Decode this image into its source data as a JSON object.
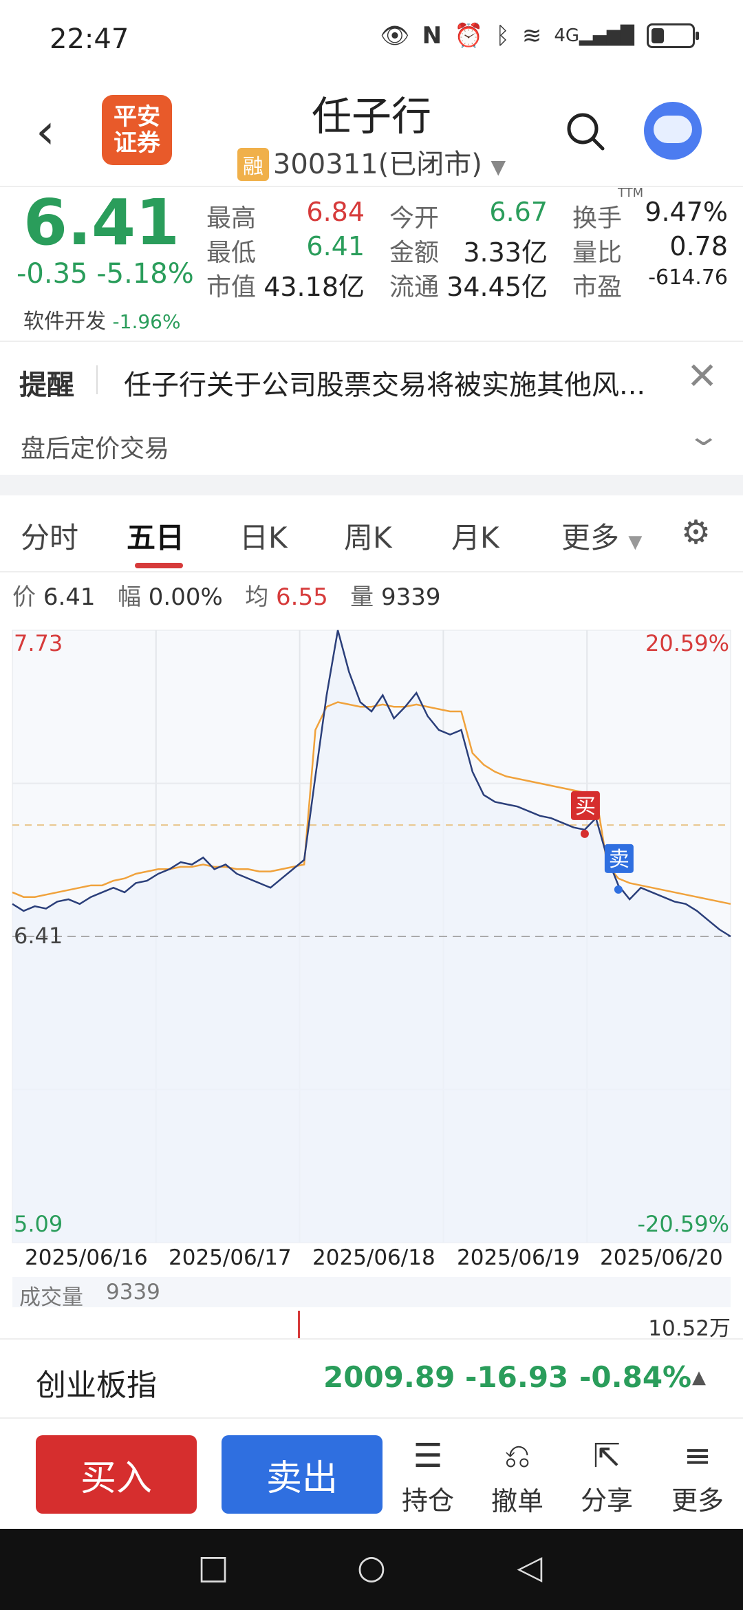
{
  "status_bar": {
    "time": "22:47",
    "icons": [
      "eye-icon",
      "nfc-icon",
      "alarm-icon",
      "bluetooth-icon",
      "wifi-icon",
      "signal-4g-icon",
      "battery-icon"
    ],
    "network": "4G",
    "battery_level": 0.35
  },
  "header": {
    "title": "任子行",
    "badge": "融",
    "code": "300311",
    "market_status": "(已闭市)",
    "logo_line1": "平安",
    "logo_line2": "证券"
  },
  "quote": {
    "price": "6.41",
    "change": "-0.35",
    "change_pct": "-5.18%",
    "sector": "软件开发",
    "sector_pct": "-1.96%",
    "fields": [
      {
        "label": "最高",
        "value": "6.84",
        "color": "red"
      },
      {
        "label": "今开",
        "value": "6.67",
        "color": "green"
      },
      {
        "label": "换手",
        "value": "9.47%",
        "color": "plain"
      },
      {
        "label": "最低",
        "value": "6.41",
        "color": "green"
      },
      {
        "label": "金额",
        "value": "3.33亿",
        "color": "plain"
      },
      {
        "label": "量比",
        "value": "0.78",
        "color": "plain"
      },
      {
        "label": "市值",
        "value": "43.18亿",
        "color": "plain"
      },
      {
        "label": "流通",
        "value": "34.45亿",
        "color": "plain"
      },
      {
        "label": "市盈",
        "value": "-614.76",
        "color": "plain"
      }
    ],
    "ttm": "TTM"
  },
  "notice": {
    "label": "提醒",
    "text": "任子行关于公司股票交易将被实施其他风...",
    "after_hours": "盘后定价交易"
  },
  "tabs": [
    {
      "label": "分时"
    },
    {
      "label": "五日"
    },
    {
      "label": "日K"
    },
    {
      "label": "周K"
    },
    {
      "label": "月K"
    },
    {
      "label": "更多"
    }
  ],
  "info_bar": {
    "price_label": "价",
    "price": "6.41",
    "amp_label": "幅",
    "amp": "0.00%",
    "avg_label": "均",
    "avg": "6.55",
    "vol_label": "量",
    "vol": "9339"
  },
  "chart_data": {
    "type": "line",
    "y_top_label": "7.73",
    "y_bottom_label": "5.09",
    "pct_top": "20.59%",
    "pct_bottom": "-20.59%",
    "current_label": "6.41",
    "ylim": [
      5.09,
      7.73
    ],
    "prev_close_ref": 6.89,
    "current_price": 6.41,
    "days": [
      "2025/06/16",
      "2025/06/17",
      "2025/06/18",
      "2025/06/19",
      "2025/06/20"
    ],
    "series": [
      {
        "values": [
          6.55,
          6.52,
          6.54,
          6.53,
          6.56,
          6.57,
          6.55,
          6.58,
          6.6,
          6.62,
          6.6,
          6.64,
          6.65,
          6.68,
          6.7,
          6.73,
          6.72,
          6.75,
          6.7,
          6.72,
          6.68,
          6.66,
          6.64,
          6.62,
          6.66,
          6.7,
          6.74,
          7.1,
          7.45,
          7.73,
          7.55,
          7.42,
          7.38,
          7.45,
          7.35,
          7.4,
          7.46,
          7.36,
          7.3,
          7.28,
          7.3,
          7.12,
          7.02,
          6.99,
          6.98,
          6.97,
          6.95,
          6.93,
          6.92,
          6.9,
          6.88,
          6.87,
          6.92,
          6.75,
          6.63,
          6.57,
          6.62,
          6.6,
          6.58,
          6.56,
          6.55,
          6.52,
          6.48,
          6.44,
          6.41
        ]
      },
      {
        "values": [
          6.6,
          6.58,
          6.58,
          6.59,
          6.6,
          6.61,
          6.62,
          6.63,
          6.63,
          6.65,
          6.66,
          6.68,
          6.69,
          6.7,
          6.7,
          6.71,
          6.71,
          6.72,
          6.71,
          6.71,
          6.7,
          6.7,
          6.69,
          6.69,
          6.7,
          6.71,
          6.72,
          7.3,
          7.4,
          7.42,
          7.41,
          7.4,
          7.4,
          7.41,
          7.4,
          7.4,
          7.41,
          7.4,
          7.39,
          7.38,
          7.38,
          7.2,
          7.15,
          7.12,
          7.1,
          7.09,
          7.08,
          7.07,
          7.06,
          7.05,
          7.04,
          7.03,
          7.02,
          6.72,
          6.66,
          6.64,
          6.63,
          6.62,
          6.61,
          6.6,
          6.59,
          6.58,
          6.57,
          6.56,
          6.55
        ]
      }
    ],
    "markers": [
      {
        "label": "买",
        "index": 51
      },
      {
        "label": "卖",
        "index": 54
      }
    ]
  },
  "volume": {
    "label": "成交量",
    "value": "9339",
    "max_label": "10.52万"
  },
  "index_bar": {
    "name": "创业板指",
    "value": "2009.89",
    "change": "-16.93",
    "change_pct": "-0.84%"
  },
  "bottom_bar": {
    "buy": "买入",
    "sell": "卖出",
    "hold": "持仓",
    "cancel": "撤单",
    "share": "分享",
    "more": "更多"
  },
  "colors": {
    "up": "#d63a3a",
    "down": "#2a9d5b",
    "price_line": "#2b3f7a",
    "avg_line": "#f0a23c",
    "buy": "#d62e2e",
    "sell": "#2f6fe0"
  }
}
